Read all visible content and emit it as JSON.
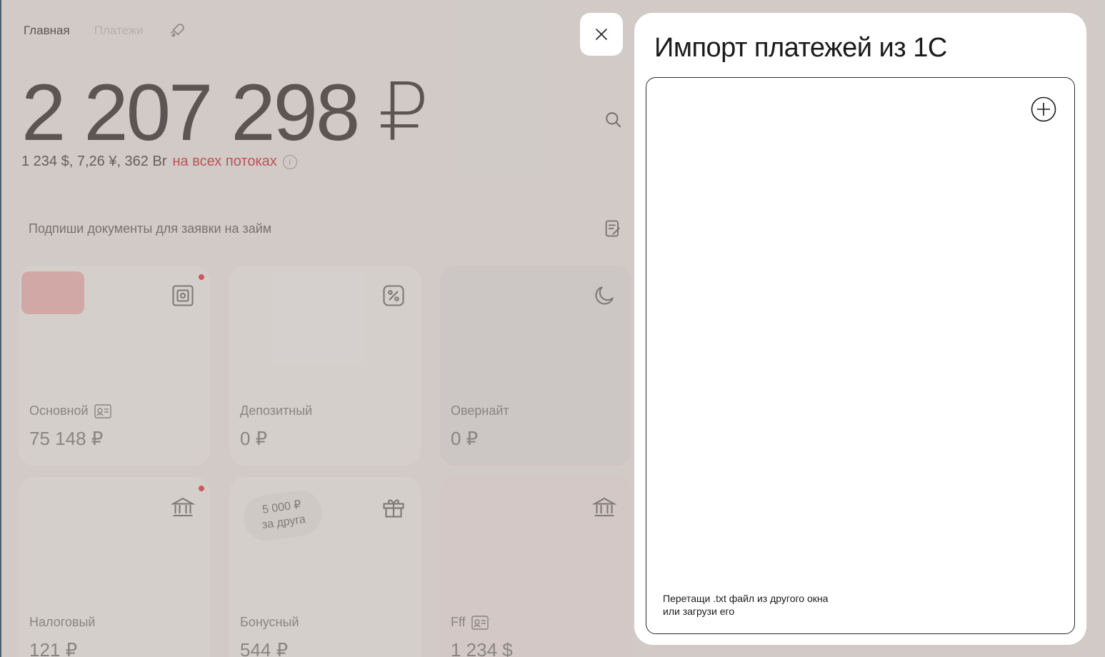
{
  "background": {
    "nav": {
      "home": "Главная",
      "payments": "Платежи"
    },
    "balance": "2 207 298 ₽",
    "balance_sub": {
      "currencies": "1 234 $, 7,26 ¥, 362 Br",
      "flows": "на всех потоках"
    },
    "promo": "Подпиши документы для заявки на займ",
    "cards": [
      {
        "name": "Основной",
        "amount": "75 148 ₽"
      },
      {
        "name": "Депозитный",
        "amount": "0 ₽"
      },
      {
        "name": "Овернайт",
        "amount": "0 ₽"
      },
      {
        "name": "Налоговый",
        "amount": "121 ₽"
      },
      {
        "name": "Бонусный",
        "amount": "544 ₽",
        "badge_line1": "5 000 ₽",
        "badge_line2": "за друга"
      },
      {
        "name": "Fff",
        "amount": "1 234 $"
      }
    ]
  },
  "modal": {
    "title": "Импорт платежей из 1С",
    "dropzone_hint": "Перетащи .txt файл из другого окна или загрузи его"
  },
  "icons": {
    "close": "close-icon",
    "add": "plus-circle-icon"
  }
}
